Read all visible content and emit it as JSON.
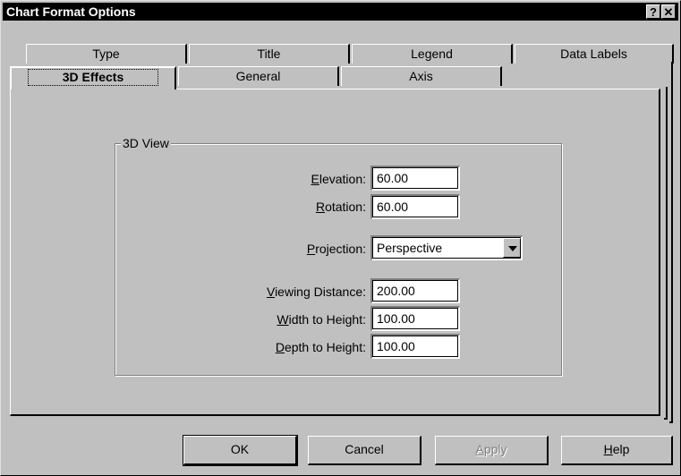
{
  "window": {
    "title": "Chart Format Options",
    "help_glyph": "?",
    "close_glyph": "✕"
  },
  "tabs": {
    "row_back": [
      {
        "label": "Type"
      },
      {
        "label": "Title"
      },
      {
        "label": "Legend"
      },
      {
        "label": "Data Labels"
      }
    ],
    "row_front": [
      {
        "label": "3D Effects",
        "selected": true
      },
      {
        "label": "General"
      },
      {
        "label": "Axis"
      }
    ]
  },
  "group": {
    "title": "3D View",
    "fields": {
      "elevation": {
        "label_pre": "",
        "label_key": "E",
        "label_post": "levation:",
        "value": "60.00"
      },
      "rotation": {
        "label_pre": "",
        "label_key": "R",
        "label_post": "otation:",
        "value": "60.00"
      },
      "projection": {
        "label_pre": "",
        "label_key": "P",
        "label_post": "rojection:",
        "value": "Perspective"
      },
      "viewing_distance": {
        "label_pre": "",
        "label_key": "V",
        "label_post": "iewing Distance:",
        "value": "200.00"
      },
      "width_to_height": {
        "label_pre": "",
        "label_key": "W",
        "label_post": "idth to Height:",
        "value": "100.00"
      },
      "depth_to_height": {
        "label_pre": "",
        "label_key": "D",
        "label_post": "epth to Height:",
        "value": "100.00"
      }
    }
  },
  "buttons": {
    "ok": "OK",
    "cancel": "Cancel",
    "apply_pre": "",
    "apply_key": "A",
    "apply_post": "pply",
    "help_pre": "",
    "help_key": "H",
    "help_post": "elp"
  }
}
